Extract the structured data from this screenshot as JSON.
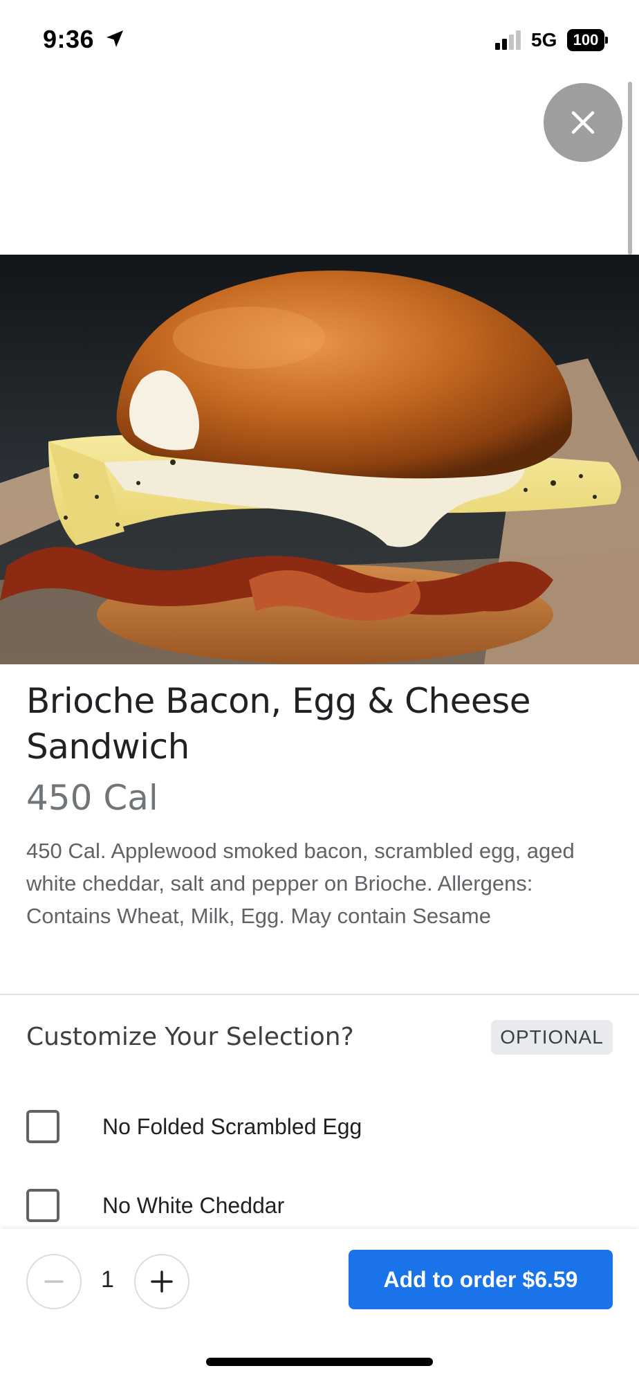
{
  "status_bar": {
    "time": "9:36",
    "network": "5G",
    "battery": "100"
  },
  "icons": {
    "close": "close-icon",
    "location": "location-arrow-icon",
    "signal": "signal-icon",
    "minus": "minus-icon",
    "plus": "plus-icon"
  },
  "product": {
    "title": "Brioche Bacon, Egg & Cheese Sandwich",
    "calories": "450 Cal",
    "description": "450 Cal. Applewood smoked bacon, scrambled egg, aged white cheddar, salt and pepper on Brioche. Allergens: Contains Wheat, Milk, Egg. May contain Sesame"
  },
  "customize": {
    "title": "Customize Your Selection?",
    "badge": "OPTIONAL",
    "options": [
      {
        "label": "No Folded Scrambled Egg",
        "checked": false
      },
      {
        "label": "No White Cheddar",
        "checked": false
      }
    ]
  },
  "order": {
    "quantity": "1",
    "add_label": "Add to order $6.59"
  },
  "colors": {
    "accent": "#1a73e8",
    "close_bg": "#9e9e9e"
  }
}
